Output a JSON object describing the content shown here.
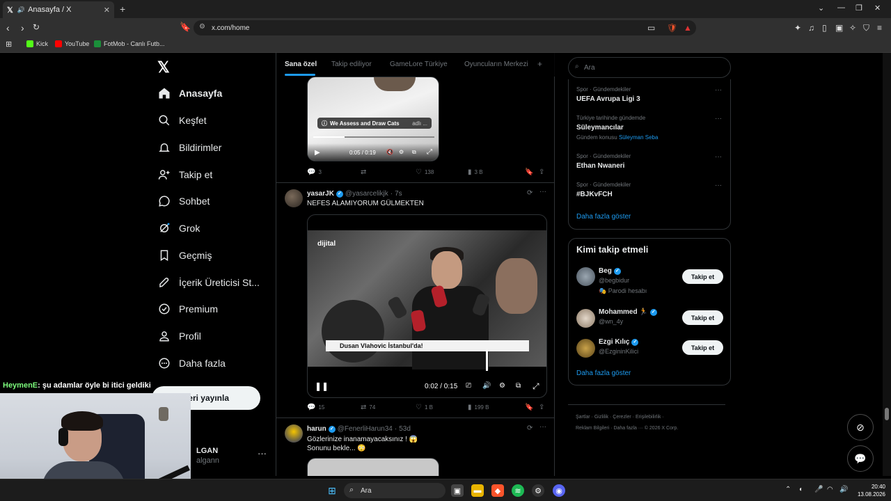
{
  "browser": {
    "tab_title": "Anasayfa / X",
    "url": "x.com/home",
    "bookmarks": [
      "Kick",
      "YouTube",
      "FotMob - Canlı Futb..."
    ]
  },
  "nav": {
    "items": [
      {
        "label": "Anasayfa",
        "icon": "home-icon"
      },
      {
        "label": "Keşfet",
        "icon": "search-icon"
      },
      {
        "label": "Bildirimler",
        "icon": "bell-icon"
      },
      {
        "label": "Takip et",
        "icon": "add-user-icon"
      },
      {
        "label": "Sohbet",
        "icon": "chat-icon"
      },
      {
        "label": "Grok",
        "icon": "grok-icon"
      },
      {
        "label": "Geçmiş",
        "icon": "bookmark-icon"
      },
      {
        "label": "İçerik Üreticisi St...",
        "icon": "rocket-icon"
      },
      {
        "label": "Premium",
        "icon": "verified-icon"
      },
      {
        "label": "Profil",
        "icon": "profile-icon"
      },
      {
        "label": "Daha fazla",
        "icon": "more-icon"
      }
    ],
    "post_button": "deri yayınla",
    "account_name": "LGAN",
    "account_handle": "algann"
  },
  "feed": {
    "tabs": [
      "Sana özel",
      "Takip ediliyor",
      "GameLore Türkiye",
      "Oyuncuların Merkezi"
    ],
    "tweet1": {
      "video_label": "We Assess and Draw Cats",
      "video_label_sub": "adlı ...",
      "time": "0:05 / 0:19",
      "progress": 0.26,
      "replies": "3",
      "likes": "138",
      "views": "3 B"
    },
    "tweet2": {
      "name": "yasarJK",
      "handle": "@yasarcelikjk",
      "age": "7s",
      "text": "NEFES ALAMIYORUM GÜLMEKTEN",
      "video_brand": "dijital",
      "video_caption": "Dusan Vlahovic İstanbul'da!",
      "time": "0:02 / 0:15",
      "progress": 0.13,
      "replies": "15",
      "retweets": "74",
      "likes": "1 B",
      "views": "199 B"
    },
    "tweet3": {
      "name": "harun",
      "handle": "@FenerliHarun34",
      "age": "53d",
      "text_line1": "Gözlerinize inanamayacaksınız ! 😱",
      "text_line2": "Sonunu bekle... 😳"
    }
  },
  "sidebar": {
    "search_placeholder": "Ara",
    "trends": [
      {
        "category": "Spor · Gündemdekiler",
        "title": "UEFA Avrupa Ligi 3"
      },
      {
        "category": "Türkiye tarihinde gündemde",
        "title": "Süleymancılar",
        "sub_prefix": "Gündem konusu",
        "sub_link": "Süleyman Seba"
      },
      {
        "category": "Spor · Gündemdekiler",
        "title": "Ethan Nwaneri"
      },
      {
        "category": "Spor · Gündemdekiler",
        "title": "#BJKvFCH"
      }
    ],
    "trends_more": "Daha fazla göster",
    "who_title": "Kimi takip etmeli",
    "who": [
      {
        "name": "Beg",
        "handle": "@begbidur",
        "note": "Parodi hesabı"
      },
      {
        "name": "Mohammed 🏃",
        "handle": "@wn_4y"
      },
      {
        "name": "Ezgi Kılıç",
        "handle": "@EzgininKilici"
      }
    ],
    "follow_label": "Takip et",
    "who_more": "Daha fazla göster",
    "footer_line1": "Şartlar · Gizlilik · Çerezler · Erişilebilirlik ·",
    "footer_line2": "Reklam Bilgileri · Daha fazla ··· © 2026 X Corp."
  },
  "stream": {
    "chat_user": "HeymenE",
    "chat_text": ": şu adamlar öyle bi itici geldiki"
  },
  "taskbar": {
    "search_label": "Ara",
    "time": "20:40",
    "date": "13.08.2026"
  },
  "colors": {
    "accent": "#1d9bf0",
    "background": "#000000",
    "border": "#2f3336"
  }
}
